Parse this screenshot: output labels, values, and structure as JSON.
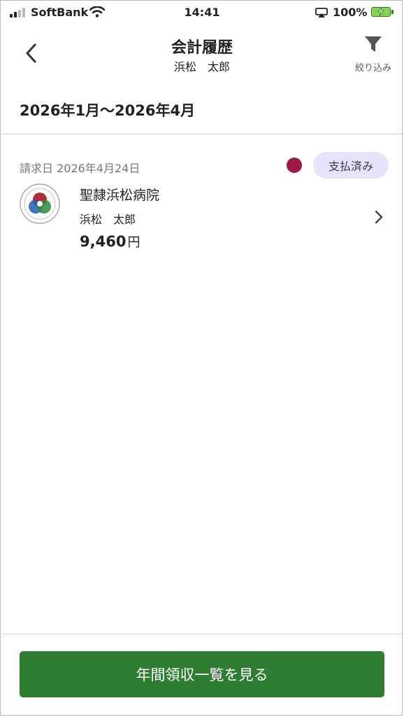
{
  "status_bar": {
    "carrier": "SoftBank",
    "time": "14:41",
    "battery": "100%"
  },
  "header": {
    "title": "会計履歴",
    "subtitle": "浜松　太郎",
    "filter_label": "絞り込み"
  },
  "period": "2026年1月～2026年4月",
  "records": [
    {
      "billing_date": "請求日 2026年4月24日",
      "status": "支払済み",
      "status_dot_color": "#9c1a44",
      "hospital": "聖隷浜松病院",
      "patient": "浜松　太郎",
      "amount": "9,460",
      "currency": "円"
    }
  ],
  "footer": {
    "button_label": "年間領収一覧を見る"
  },
  "colors": {
    "primary": "#2e7d32",
    "badge_bg": "#e7e3fb"
  }
}
